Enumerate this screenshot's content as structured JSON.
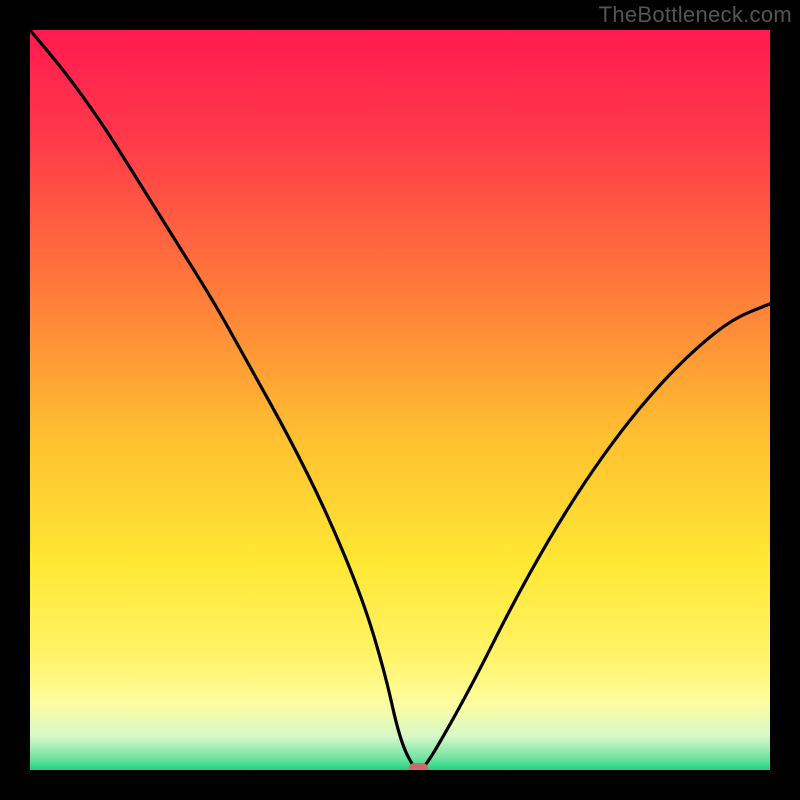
{
  "watermark": "TheBottleneck.com",
  "chart_data": {
    "type": "line",
    "title": "",
    "xlabel": "",
    "ylabel": "",
    "xlim": [
      0,
      100
    ],
    "ylim": [
      0,
      100
    ],
    "grid": false,
    "note": "Axes untick-labeled; x represents relative hardware match position, y represents bottleneck percentage. Values estimated from the rendered curve.",
    "x": [
      0,
      5,
      10,
      15,
      20,
      25,
      30,
      35,
      40,
      45,
      48,
      50,
      52,
      53,
      55,
      60,
      65,
      70,
      75,
      80,
      85,
      90,
      95,
      100
    ],
    "y": [
      100,
      94,
      87,
      79,
      71,
      63,
      54,
      45,
      35,
      23,
      13,
      4,
      0,
      0,
      3,
      12,
      22,
      31,
      39,
      46,
      52,
      57,
      61,
      63
    ],
    "marker": {
      "x": 52.5,
      "y": 0,
      "color": "#d06a6a"
    },
    "background_gradient": {
      "direction": "vertical",
      "stops": [
        {
          "pos": 0.0,
          "color": "#ff1a50"
        },
        {
          "pos": 0.15,
          "color": "#ff3a4a"
        },
        {
          "pos": 0.35,
          "color": "#ff7a3a"
        },
        {
          "pos": 0.55,
          "color": "#ffc030"
        },
        {
          "pos": 0.72,
          "color": "#ffe733"
        },
        {
          "pos": 0.85,
          "color": "#fff46a"
        },
        {
          "pos": 0.91,
          "color": "#fdfda0"
        },
        {
          "pos": 0.955,
          "color": "#d6f8c8"
        },
        {
          "pos": 0.985,
          "color": "#6fe2a0"
        },
        {
          "pos": 1.0,
          "color": "#18d67f"
        }
      ]
    }
  }
}
